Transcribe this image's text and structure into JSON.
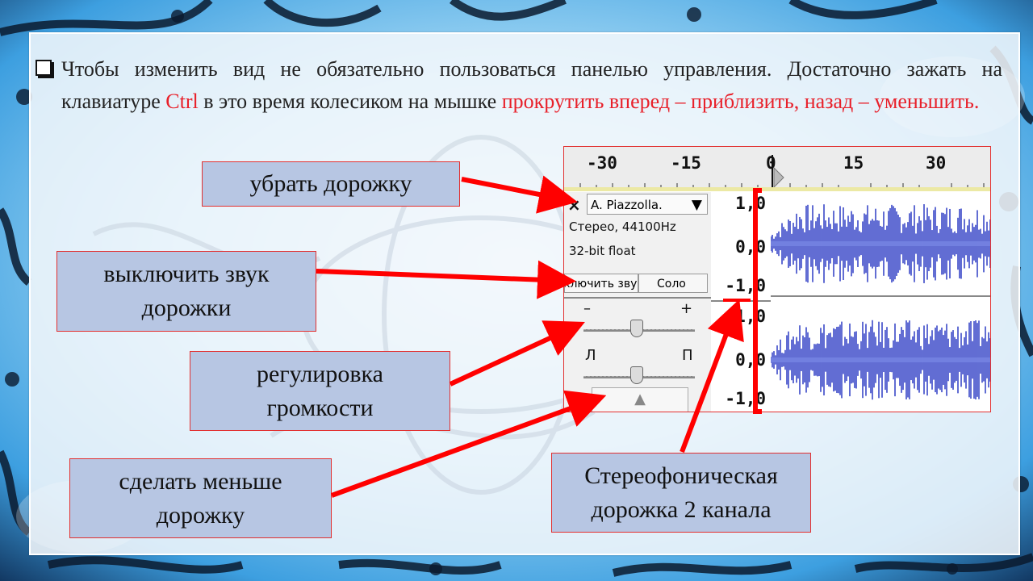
{
  "slide": {
    "text_part1": "Чтобы изменить вид не обязательно пользоваться панелью управления. Достаточно зажать на клавиатуре ",
    "text_ctrl": "Ctrl",
    "text_part2": " в это время колесиком на мышке ",
    "text_red": "прокрутить вперед – приблизить, назад – уменьшить.",
    "accent_red": "#e8202a",
    "label_fill": "#b7c6e3"
  },
  "labels": {
    "remove_track": "убрать дорожку",
    "mute_line1": "выключить звук",
    "mute_line2": "дорожки",
    "volume_line1": "регулировка",
    "volume_line2": "громкости",
    "shrink_line1": "сделать меньше",
    "shrink_line2": "дорожку",
    "stereo_line1": "Стереофоническая",
    "stereo_line2": "дорожка 2 канала"
  },
  "audacity": {
    "ruler_ticks": [
      "-30",
      "-15",
      "0",
      "15",
      "30"
    ],
    "close_glyph": "×",
    "track_name": "A. Piazzolla.",
    "track_caret": "▼",
    "format_line1": "Стерео, 44100Hz",
    "format_line2": "32-bit float",
    "mute_button": "ключить звук",
    "solo_button": "Соло",
    "vol_minus": "–",
    "vol_plus": "+",
    "pan_left": "Л",
    "pan_right": "П",
    "collapse_glyph": "▲",
    "scale_top": [
      "1,0",
      "0,0",
      "-1,0"
    ],
    "scale_bottom": [
      "1,0",
      "0,0",
      "-1,0"
    ],
    "waveform_color": "#3b49c8"
  }
}
